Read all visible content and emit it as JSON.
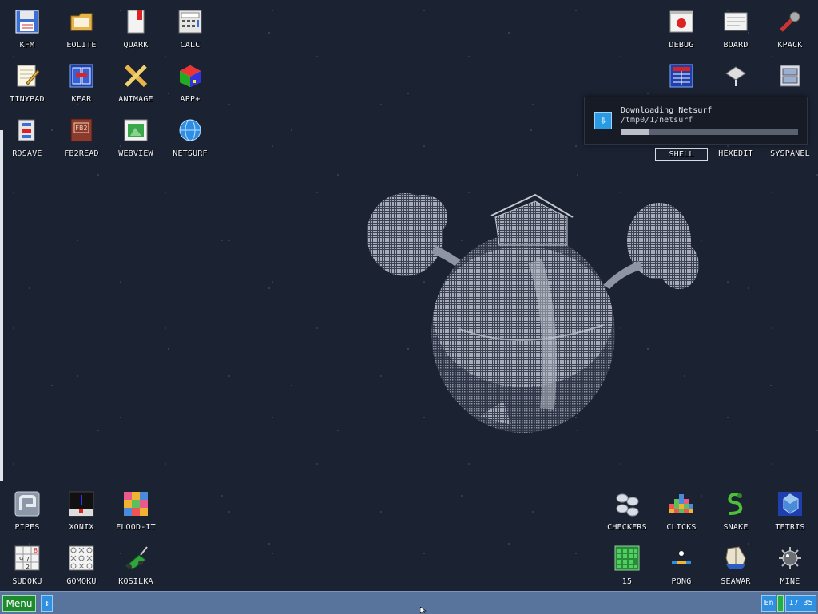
{
  "desktop": {
    "top_left_icons": [
      {
        "label": "KFM",
        "icon": "floppy-disk-icon"
      },
      {
        "label": "EOLITE",
        "icon": "folder-icon"
      },
      {
        "label": "QUARK",
        "icon": "notebook-icon"
      },
      {
        "label": "CALC",
        "icon": "calculator-icon"
      },
      {
        "label": "TINYPAD",
        "icon": "notepad-icon"
      },
      {
        "label": "KFAR",
        "icon": "file-manager-icon"
      },
      {
        "label": "ANIMAGE",
        "icon": "pencil-ruler-icon"
      },
      {
        "label": "APP+",
        "icon": "rubik-cube-icon"
      },
      {
        "label": "RDSAVE",
        "icon": "disk-save-icon"
      },
      {
        "label": "FB2READ",
        "icon": "fb2-book-icon"
      },
      {
        "label": "WEBVIEW",
        "icon": "webpage-icon"
      },
      {
        "label": "NETSURF",
        "icon": "globe-icon"
      }
    ],
    "top_right_icons": [
      {
        "label": "DEBUG",
        "icon": "bug-window-icon"
      },
      {
        "label": "BOARD",
        "icon": "board-window-icon"
      },
      {
        "label": "KPACK",
        "icon": "wrench-icon"
      },
      {
        "label": "",
        "icon": "grid-table-icon"
      },
      {
        "label": "",
        "icon": "network-drive-icon"
      },
      {
        "label": "",
        "icon": "cabinet-icon"
      },
      {
        "label": "SHELL",
        "icon": "shell-icon"
      },
      {
        "label": "HEXEDIT",
        "icon": "hexedit-icon"
      },
      {
        "label": "SYSPANEL",
        "icon": "syspanel-icon"
      }
    ],
    "bottom_left_icons": [
      {
        "label": "PIPES",
        "icon": "pipes-icon"
      },
      {
        "label": "XONIX",
        "icon": "xonix-icon"
      },
      {
        "label": "FLOOD-IT",
        "icon": "flood-it-icon"
      },
      {
        "label": "SUDOKU",
        "icon": "sudoku-icon"
      },
      {
        "label": "GOMOKU",
        "icon": "gomoku-icon"
      },
      {
        "label": "KOSILKA",
        "icon": "lawnmower-icon"
      }
    ],
    "bottom_right_icons": [
      {
        "label": "CHECKERS",
        "icon": "checkers-icon"
      },
      {
        "label": "CLICKS",
        "icon": "clicks-icon"
      },
      {
        "label": "SNAKE",
        "icon": "snake-icon"
      },
      {
        "label": "TETRIS",
        "icon": "tetris-icon"
      },
      {
        "label": "15",
        "icon": "fifteen-puzzle-icon"
      },
      {
        "label": "PONG",
        "icon": "pong-icon"
      },
      {
        "label": "SEAWAR",
        "icon": "seawar-icon"
      },
      {
        "label": "MINE",
        "icon": "mine-icon"
      }
    ]
  },
  "notification": {
    "title": "Downloading Netsurf",
    "path": "/tmp0/1/netsurf",
    "progress": 0.16,
    "icon": "download-arrow-icon"
  },
  "taskbar": {
    "menu_label": "Menu",
    "switch_glyph": "↕",
    "language": "En",
    "clock": "17 35"
  },
  "colors": {
    "desktop_bg": "#1b2231",
    "taskbar": "#58739c",
    "menu_button": "#1d8a2d",
    "tray_button": "#2f8fe0"
  }
}
